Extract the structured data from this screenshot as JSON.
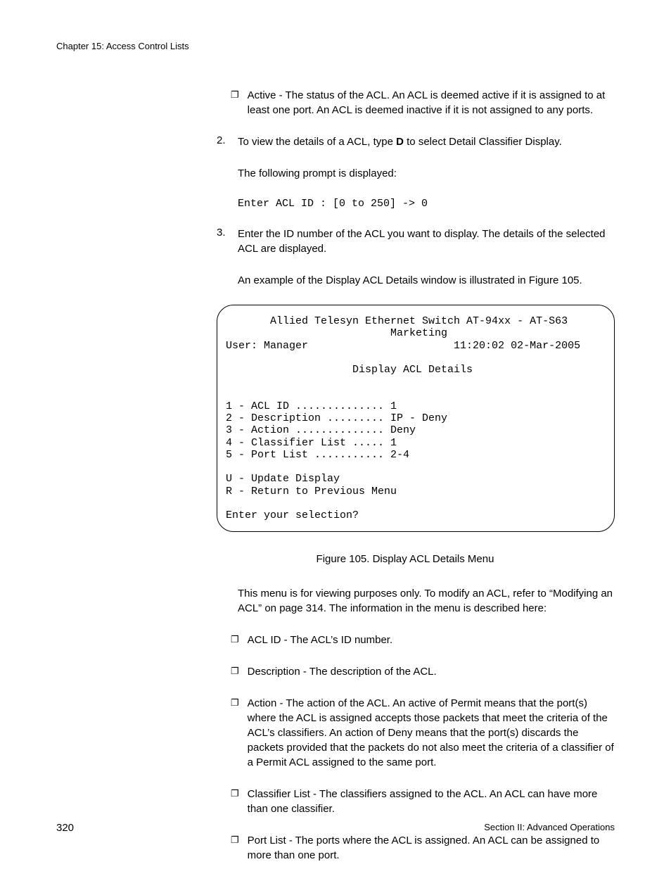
{
  "header": {
    "chapter": "Chapter 15: Access Control Lists"
  },
  "items": {
    "bullet_active": "Active - The status of the ACL. An ACL is deemed active if it is assigned to at least one port. An ACL is deemed inactive if it is not assigned to any ports.",
    "step2_prefix": "2.",
    "step2_text_a": "To view the details of a ACL, type ",
    "step2_bold": "D",
    "step2_text_b": " to select Detail Classifier Display.",
    "step2_para": "The following prompt is displayed:",
    "step2_mono": "Enter ACL ID :  [0 to 250] -> 0",
    "step3_prefix": "3.",
    "step3_text": "Enter the ID number of the ACL you want to display. The details of the selected ACL are displayed.",
    "step3_para": "An example of the Display ACL Details window is illustrated in Figure 105."
  },
  "terminal": "       Allied Telesyn Ethernet Switch AT-94xx - AT-S63\n                          Marketing\nUser: Manager                       11:20:02 02-Mar-2005\n\n                    Display ACL Details\n\n\n1 - ACL ID .............. 1\n2 - Description ......... IP - Deny\n3 - Action .............. Deny\n4 - Classifier List ..... 1\n5 - Port List ........... 2-4\n\nU - Update Display\nR - Return to Previous Menu\n\nEnter your selection?",
  "figure_caption": "Figure 105. Display ACL Details Menu",
  "post_para": "This menu is for viewing purposes only. To modify an ACL, refer to “Modifying an ACL” on page 314. The information in the menu is described here:",
  "bullets": {
    "b1": "ACL ID - The ACL’s ID number.",
    "b2": "Description - The description of the ACL.",
    "b3": "Action - The action of the ACL. An active of Permit means that the port(s) where the ACL is assigned accepts those packets that meet the criteria of the ACL’s classifiers. An action of Deny means that the port(s) discards the packets provided that the packets do not also meet the criteria of a classifier of a Permit ACL assigned to the same port.",
    "b4": "Classifier List - The classifiers assigned to the ACL. An ACL can have more than one classifier.",
    "b5": "Port List - The ports where the ACL is assigned. An ACL can be assigned to more than one port."
  },
  "footer": {
    "page": "320",
    "section": "Section II: Advanced Operations"
  }
}
